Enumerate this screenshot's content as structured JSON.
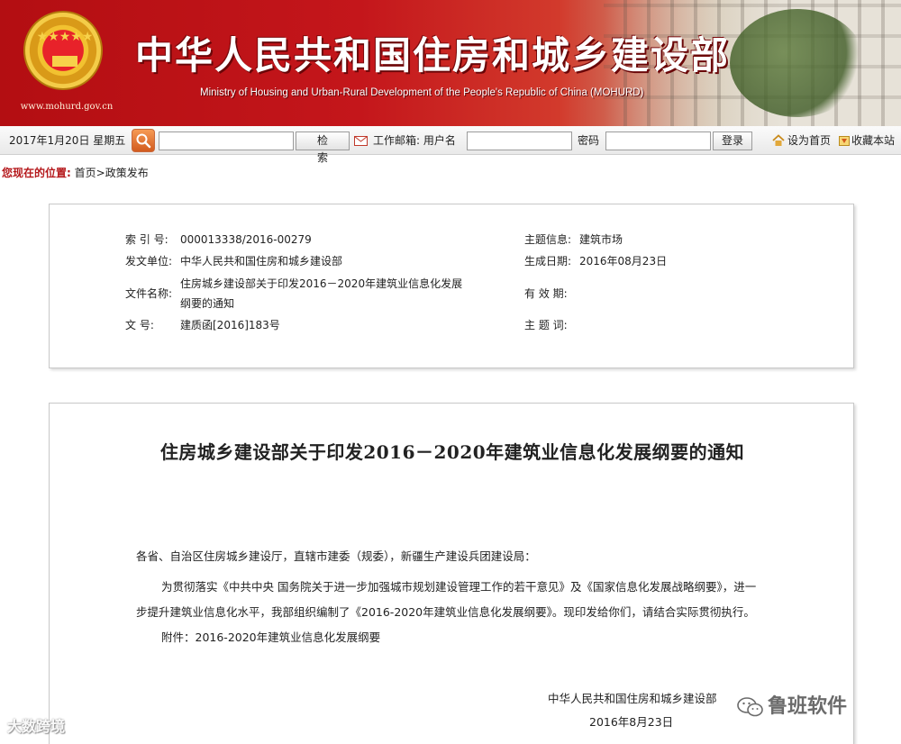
{
  "header": {
    "site_title": "中华人民共和国住房和城乡建设部",
    "site_subtitle": "Ministry of Housing and Urban-Rural Development of the People's Republic of China (MOHURD)",
    "site_url": "www.mohurd.gov.cn"
  },
  "toolbar": {
    "date": "2017年1月20日  星期五",
    "search_button": "检  索",
    "mail_label": "工作邮箱: 用户名",
    "password_label": "密码",
    "login_button": "登录",
    "set_home": "设为首页",
    "bookmark": "收藏本站"
  },
  "breadcrumb": {
    "label": "您现在的位置:",
    "path": "首页>政策发布"
  },
  "meta": {
    "index_no_label": "索 引 号:",
    "index_no": "000013338/2016-00279",
    "issuer_label": "发文单位:",
    "issuer": "中华人民共和国住房和城乡建设部",
    "filename_label": "文件名称:",
    "filename": "住房城乡建设部关于印发2016－2020年建筑业信息化发展纲要的通知",
    "doc_no_label": "文      号:",
    "doc_no": "建质函[2016]183号",
    "subject_label": "主题信息:",
    "subject": "建筑市场",
    "created_label": "生成日期:",
    "created": "2016年08月23日",
    "valid_label": "有 效 期:",
    "valid": "",
    "keywords_label": "主 题 词:",
    "keywords": ""
  },
  "document": {
    "title": "住房城乡建设部关于印发2016－2020年建筑业信息化发展纲要的通知",
    "salutation": "各省、自治区住房城乡建设厅，直辖市建委（规委），新疆生产建设兵团建设局：",
    "body": "为贯彻落实《中共中央 国务院关于进一步加强城市规划建设管理工作的若干意见》及《国家信息化发展战略纲要》，进一步提升建筑业信息化水平，我部组织编制了《2016-2020年建筑业信息化发展纲要》。现印发给你们，请结合实际贯彻执行。",
    "attachment": "附件：2016-2020年建筑业信息化发展纲要",
    "signature": "中华人民共和国住房和城乡建设部",
    "date": "2016年8月23日"
  },
  "watermarks": {
    "left": "大数跨境",
    "right": "鲁班软件"
  },
  "colors": {
    "banner_red": "#c4161b",
    "breadcrumb_red": "#b5191c"
  }
}
